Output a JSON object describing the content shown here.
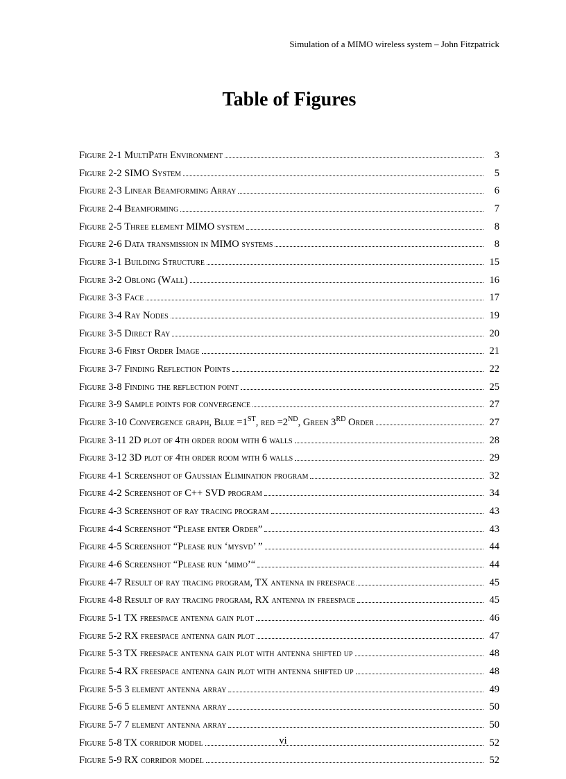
{
  "runningHead": "Simulation of a MIMO wireless system – John Fitzpatrick",
  "title": "Table of Figures",
  "pageNumber": "vi",
  "entries": [
    {
      "prefix": "Figure ",
      "num": "2-1 ",
      "caption_sc": "MultiPath Environment",
      "page": "3"
    },
    {
      "prefix": "Figure ",
      "num": "2-2 SIMO ",
      "caption_sc": "System",
      "page": "5"
    },
    {
      "prefix": "Figure ",
      "num": "2-3 ",
      "caption_sc": "Linear Beamforming Array",
      "page": "6"
    },
    {
      "prefix": "Figure ",
      "num": "2-4 ",
      "caption_sc": "Beamforming",
      "page": "7"
    },
    {
      "prefix": "Figure ",
      "num": "2-5 ",
      "caption_sc": "Three element MIMO system",
      "page": "8"
    },
    {
      "prefix": "Figure ",
      "num": "2-6 ",
      "caption_sc": "Data transmission in MIMO systems",
      "page": "8"
    },
    {
      "prefix": "Figure ",
      "num": "3-1 ",
      "caption_sc": "Building Structure",
      "page": "15"
    },
    {
      "prefix": "Figure ",
      "num": "3-2 ",
      "caption_sc": "Oblong (Wall)",
      "page": "16"
    },
    {
      "prefix": "Figure ",
      "num": "3-3 ",
      "caption_sc": "Face",
      "page": "17"
    },
    {
      "prefix": "Figure ",
      "num": "3-4 ",
      "caption_sc": "Ray Nodes",
      "page": "19"
    },
    {
      "prefix": "Figure ",
      "num": "3-5 ",
      "caption_sc": "Direct Ray",
      "page": "20"
    },
    {
      "prefix": "Figure ",
      "num": "3-6 ",
      "caption_sc": "First Order Image",
      "page": "21"
    },
    {
      "prefix": "Figure ",
      "num": "3-7 ",
      "caption_sc": "Finding Reflection Points",
      "page": "22"
    },
    {
      "prefix": "Figure ",
      "num": "3-8 ",
      "caption_sc": "Finding the reflection point",
      "page": "25"
    },
    {
      "prefix": "Figure ",
      "num": "3-9 ",
      "caption_sc": "Sample points for convergence",
      "page": "27"
    },
    {
      "prefix": "Figure ",
      "num": "3-10 ",
      "caption_sc_special": "convergence_graph",
      "page": "27"
    },
    {
      "prefix": "Figure ",
      "num": "3-11 2D ",
      "caption_sc": "plot of 4th order room with 6 walls",
      "page": "28"
    },
    {
      "prefix": "Figure ",
      "num": "3-12 3D ",
      "caption_sc": "plot of 4th order room with 6 walls",
      "page": "29"
    },
    {
      "prefix": "Figure ",
      "num": "4-1 ",
      "caption_sc": "Screenshot of Gaussian Elimination program",
      "page": "32"
    },
    {
      "prefix": "Figure ",
      "num": "4-2 ",
      "caption_sc": "Screenshot of C++ SVD program",
      "page": "34"
    },
    {
      "prefix": "Figure ",
      "num": "4-3 ",
      "caption_sc": "Screenshot of ray tracing program",
      "page": "43"
    },
    {
      "prefix": "Figure ",
      "num": "4-4 ",
      "caption_sc": "Screenshot “Please enter Order”",
      "page": "43"
    },
    {
      "prefix": "Figure ",
      "num": "4-5 ",
      "caption_sc": "Screenshot “Please run ‘mysvd’ ”",
      "page": "44"
    },
    {
      "prefix": "Figure ",
      "num": "4-6 ",
      "caption_sc": "Screenshot “Please run ‘mimo’“",
      "page": "44"
    },
    {
      "prefix": "Figure ",
      "num": "4-7 ",
      "caption_sc": "Result of ray tracing program, TX antenna in freespace",
      "page": "45"
    },
    {
      "prefix": "Figure ",
      "num": "4-8 ",
      "caption_sc": "Result of ray tracing program, RX antenna in freespace",
      "page": "45"
    },
    {
      "prefix": "Figure ",
      "num": "5-1 TX ",
      "caption_sc": "freespace antenna gain plot",
      "page": "46"
    },
    {
      "prefix": "Figure ",
      "num": "5-2 RX ",
      "caption_sc": "freespace antenna gain plot",
      "page": "47"
    },
    {
      "prefix": "Figure ",
      "num": "5-3 TX ",
      "caption_sc": "freespace antenna gain plot with antenna shifted up",
      "page": "48"
    },
    {
      "prefix": "Figure ",
      "num": "5-4 RX ",
      "caption_sc": "freespace antenna gain plot with antenna shifted up",
      "page": "48"
    },
    {
      "prefix": "Figure ",
      "num": "5-5 3 ",
      "caption_sc": "element antenna array",
      "page": "49"
    },
    {
      "prefix": "Figure ",
      "num": "5-6 5 ",
      "caption_sc": "element antenna array",
      "page": "50"
    },
    {
      "prefix": "Figure ",
      "num": "5-7 7 ",
      "caption_sc": "element antenna array",
      "page": "50"
    },
    {
      "prefix": "Figure ",
      "num": "5-8 TX ",
      "caption_sc": "corridor model",
      "page": "52"
    },
    {
      "prefix": "Figure ",
      "num": "5-9 RX ",
      "caption_sc": "corridor model",
      "page": "52"
    }
  ]
}
